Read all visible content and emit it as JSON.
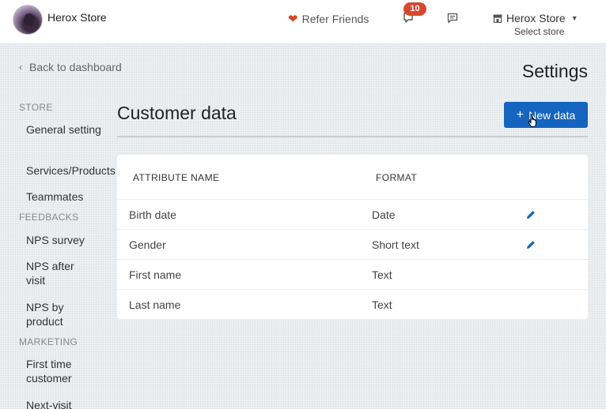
{
  "header": {
    "store_name": "Herox Store",
    "refer_label": "Refer Friends",
    "notification_count": "10",
    "store_selector_label": "Herox Store",
    "store_selector_sub": "Select store"
  },
  "subheader": {
    "back_label": "Back to dashboard",
    "page_title": "Settings"
  },
  "sidebar": {
    "sections": [
      {
        "heading": "STORE",
        "items": [
          "General setting",
          "Services/Products",
          "Teammates"
        ]
      },
      {
        "heading": "FEEDBACKS",
        "items": [
          "NPS survey",
          "NPS after visit",
          "NPS by product"
        ]
      },
      {
        "heading": "MARKETING",
        "items": [
          "First time customer",
          "Next-visit"
        ]
      }
    ]
  },
  "main": {
    "title": "Customer data",
    "new_button_label": "New data",
    "columns": [
      "ATTRIBUTE NAME",
      "FORMAT"
    ],
    "rows": [
      {
        "name": "Birth date",
        "format": "Date",
        "editable": true
      },
      {
        "name": "Gender",
        "format": "Short text",
        "editable": true
      },
      {
        "name": "First name",
        "format": "Text",
        "editable": false
      },
      {
        "name": "Last name",
        "format": "Text",
        "editable": false
      }
    ]
  },
  "colors": {
    "primary": "#1565c0",
    "badge": "#d9472b",
    "edit_icon": "#1565c0"
  },
  "icons": [
    "heart-icon",
    "notification-icon",
    "chat-icon",
    "store-icon",
    "chevron-left-icon",
    "plus-icon",
    "edit-icon",
    "hand-cursor-icon"
  ]
}
